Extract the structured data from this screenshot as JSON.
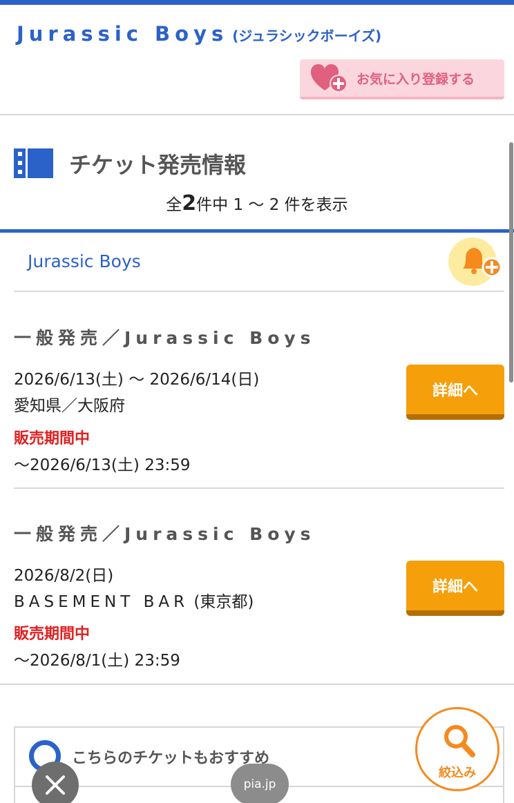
{
  "header": {
    "artist_name": "Jurassic Boys",
    "artist_kana": "(ジュラシックボーイズ)",
    "favorite_button_label": "お気に入り登録する"
  },
  "section": {
    "title": "チケット発売情報",
    "count_prefix": "全",
    "count_total": "2",
    "count_suffix": "件中 1 〜 2 件を表示"
  },
  "group": {
    "title": "Jurassic Boys"
  },
  "events": [
    {
      "title": "一般発売／Jurassic Boys",
      "dates": "2026/6/13(土) 〜 2026/6/14(日)",
      "venue": "愛知県／大阪府",
      "status": "販売期間中",
      "period": "〜2026/6/13(土) 23:59",
      "button_label": "詳細へ"
    },
    {
      "title": "一般発売／Jurassic Boys",
      "dates": "2026/8/2(日)",
      "venue": "BASEMENT BAR",
      "venue_suffix": "(東京都)",
      "status": "販売期間中",
      "period": "〜2026/8/1(土) 23:59",
      "button_label": "詳細へ"
    }
  ],
  "recommend": {
    "label": "こちらのチケットもおすすめ"
  },
  "filter_button_label": "絞込み",
  "browser": {
    "domain": "pia.jp"
  },
  "colors": {
    "brand_blue": "#2b62c9",
    "button_orange": "#f59f0a",
    "status_red": "#e02020",
    "favorite_pink": "#fcd6de"
  },
  "icons": [
    "heart-plus-icon",
    "film-strip-icon",
    "bell-plus-icon",
    "search-icon",
    "close-icon"
  ]
}
